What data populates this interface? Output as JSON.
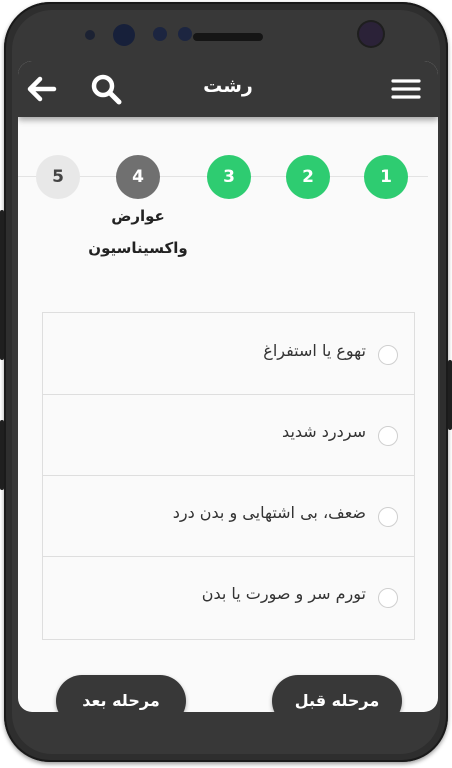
{
  "appbar": {
    "title": "رشت",
    "icons": [
      "back-arrow-icon",
      "search-icon",
      "hamburger-menu-icon"
    ]
  },
  "stepper": {
    "steps": [
      {
        "number": "1",
        "state": "done"
      },
      {
        "number": "2",
        "state": "done"
      },
      {
        "number": "3",
        "state": "done"
      },
      {
        "number": "4",
        "state": "active"
      },
      {
        "number": "5",
        "state": "todo"
      }
    ],
    "active_label_line1": "عوارض",
    "active_label_line2": "واکسیناسیون"
  },
  "options": [
    {
      "label": "تهوع یا استفراغ",
      "checked": false
    },
    {
      "label": "سردرد شدید",
      "checked": false
    },
    {
      "label": "ضعف، بی اشتهایی و بدن درد",
      "checked": false
    },
    {
      "label": "تورم سر و صورت یا بدن",
      "checked": false
    }
  ],
  "nav": {
    "prev_label": "مرحله قبل",
    "next_label": "مرحله بعد"
  },
  "colors": {
    "appbar": "#383838",
    "done": "#2ecc71",
    "active": "#707070",
    "todo": "#e8e8e8"
  }
}
